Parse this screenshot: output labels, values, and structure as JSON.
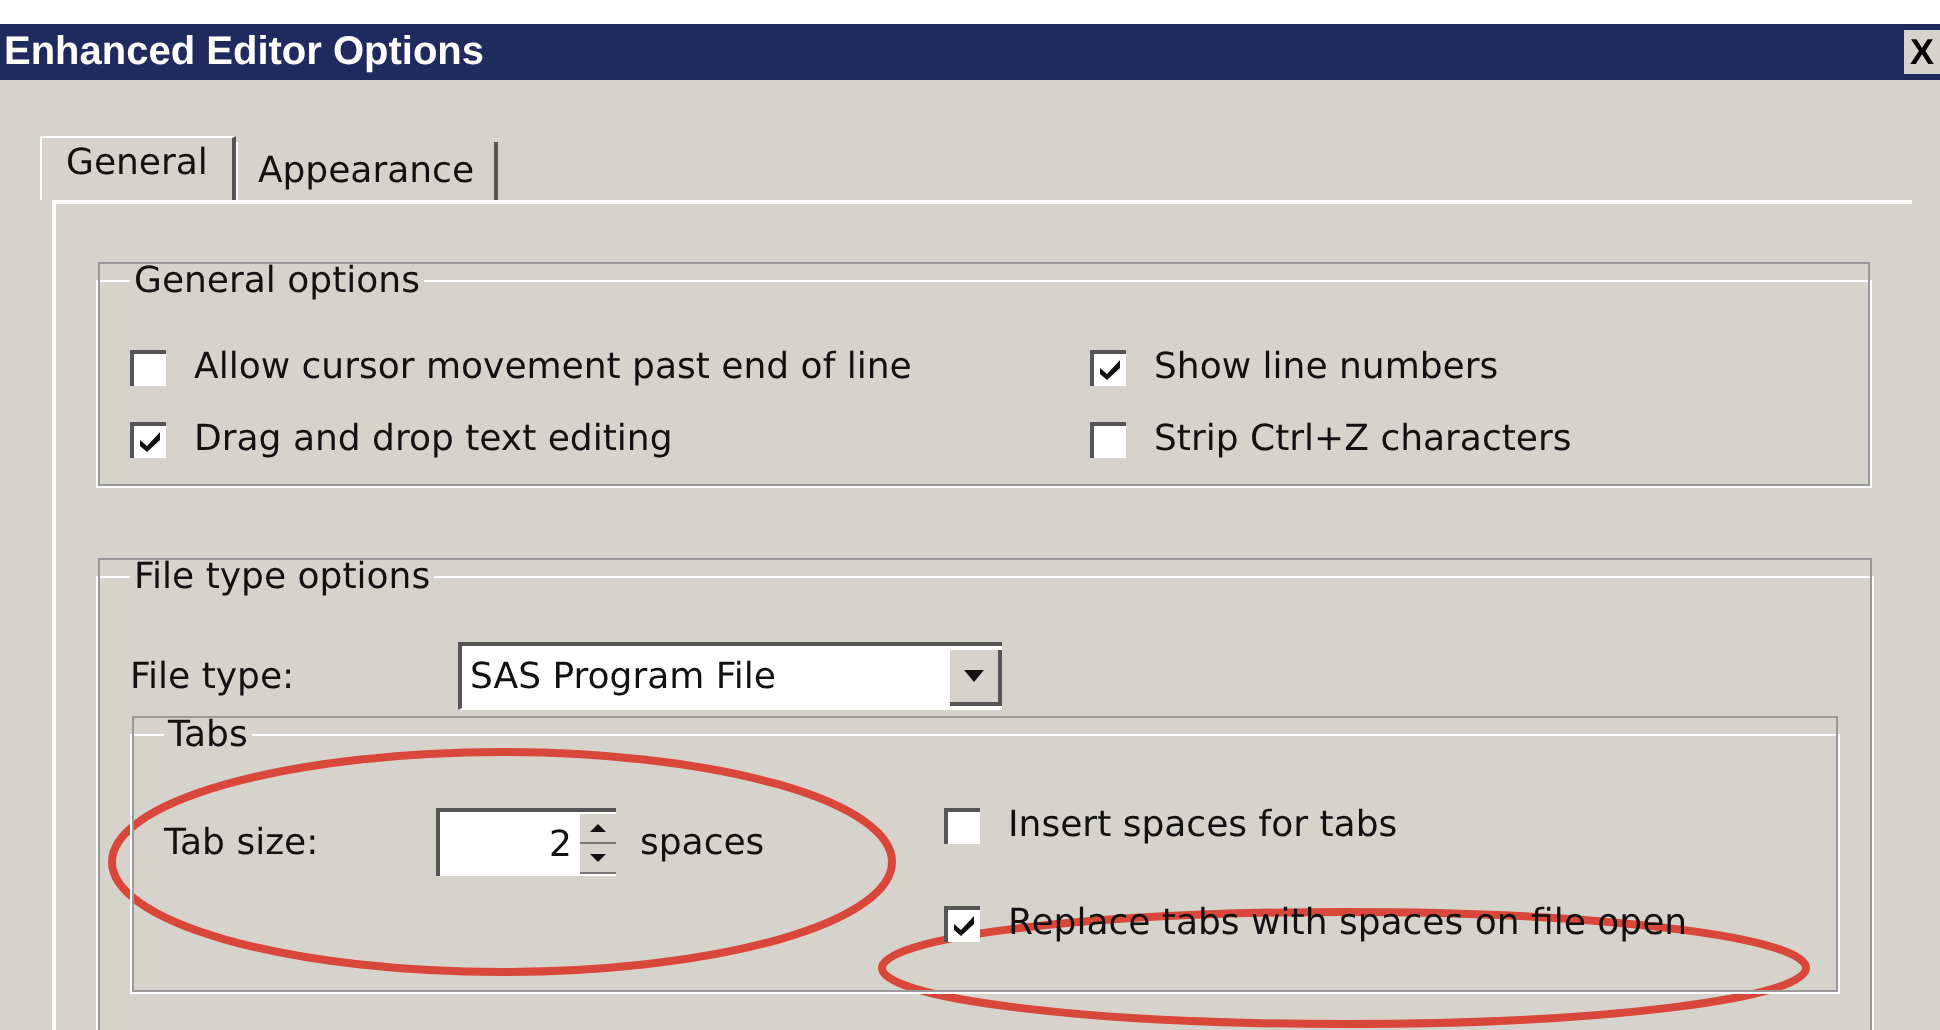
{
  "window": {
    "title": "Enhanced Editor Options",
    "close": "X"
  },
  "tabs": [
    {
      "label": "General",
      "selected": true
    },
    {
      "label": "Appearance",
      "selected": false
    }
  ],
  "general_options": {
    "title": "General options",
    "options": [
      {
        "label": "Allow cursor movement past end of line",
        "checked": false
      },
      {
        "label": "Show line numbers",
        "checked": true
      },
      {
        "label": "Drag and drop text editing",
        "checked": true
      },
      {
        "label": "Strip Ctrl+Z characters",
        "checked": false
      }
    ]
  },
  "file_type_options": {
    "title": "File type options",
    "file_type_label": "File type:",
    "file_type": "SAS Program File",
    "tabs_group": {
      "title": "Tabs",
      "tab_size_label": "Tab size:",
      "tab_size": "2",
      "tab_size_unit": "spaces",
      "options": [
        {
          "label": "Insert spaces for tabs",
          "checked": false
        },
        {
          "label": "Replace tabs with spaces on file open",
          "checked": true
        }
      ]
    }
  }
}
